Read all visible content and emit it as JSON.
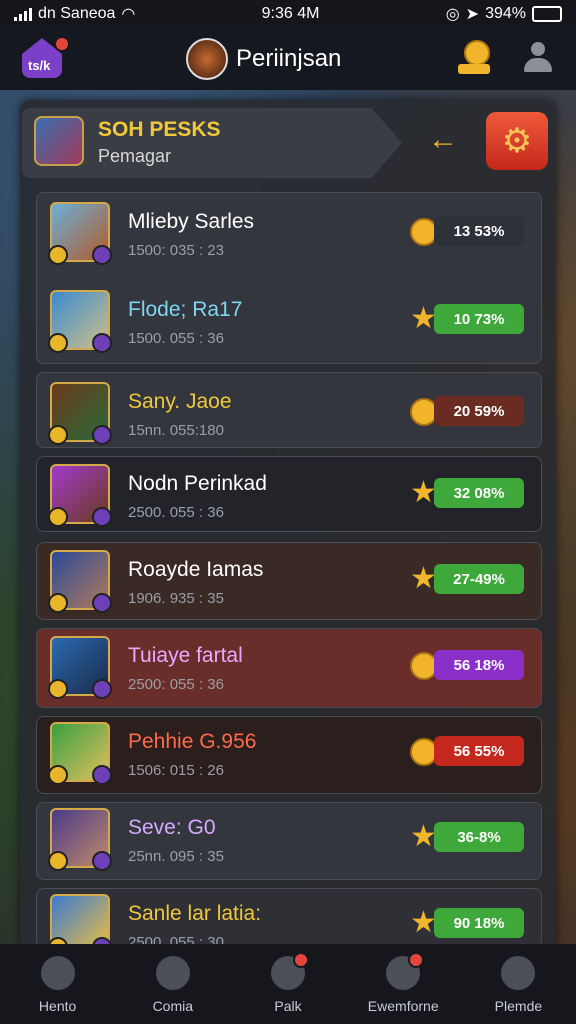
{
  "status": {
    "carrier": "dn Saneoa",
    "time": "9:36 4M",
    "battery": "394%"
  },
  "header": {
    "title": "Periinjsan",
    "home_label": "ts/k"
  },
  "section": {
    "title": "SOH PESKS",
    "subtitle": "Pemagar"
  },
  "colors": {
    "accent": "#f0c83a",
    "red": "#c4281c",
    "green": "#3fa83a",
    "purple": "#8a2fc8"
  },
  "rows": [
    {
      "name": "Mlieby Sarles",
      "meta": "1500: 035 : 23",
      "value": "13 53%",
      "icon": "coin-icon",
      "pill_color": "#2f3138",
      "name_color": "#ffffff"
    },
    {
      "name": "Flode; Ra17",
      "meta": "1500. 055 : 36",
      "value": "10 73%",
      "icon": "star-icon",
      "pill_color": "#3fa83a",
      "name_color": "#7fd6f0"
    },
    {
      "name": "Sany. Jaoe",
      "meta": "15nn. 055:180",
      "value": "20 59%",
      "icon": "coin-icon",
      "pill_color": "#6a2b22",
      "name_color": "#f0c83a"
    },
    {
      "name": "Nodn Perinkad",
      "meta": "2500. 055 : 36",
      "value": "32 08%",
      "icon": "star-icon",
      "pill_color": "#3fa83a",
      "name_color": "#ffffff"
    },
    {
      "name": "Roayde Iamas",
      "meta": "1906. 935 : 35",
      "value": "27-49%",
      "icon": "star-icon",
      "pill_color": "#3fa83a",
      "name_color": "#ffffff"
    },
    {
      "name": "Tuiaye fartal",
      "meta": "2500: 055 : 36",
      "value": "56 18%",
      "icon": "coin-icon",
      "pill_color": "#8a2fc8",
      "name_color": "#e8a8ff"
    },
    {
      "name": "Pehhie G.956",
      "meta": "1506: 015 : 26",
      "value": "56 55%",
      "icon": "coin-icon",
      "pill_color": "#c4281c",
      "name_color": "#ff6a4a"
    },
    {
      "name": "Seve: G0",
      "meta": "25nn. 095 : 35",
      "value": "36-8%",
      "icon": "star-icon",
      "pill_color": "#3fa83a",
      "name_color": "#d8a8ff"
    },
    {
      "name": "Sanle lar latia:",
      "meta": "2500. 055 : 30",
      "value": "90 18%",
      "icon": "star-icon",
      "pill_color": "#3fa83a",
      "name_color": "#f0c83a"
    }
  ],
  "tabs": [
    {
      "label": "Hento",
      "icon": "home-icon"
    },
    {
      "label": "Comia",
      "icon": "cat-icon"
    },
    {
      "label": "Palk",
      "icon": "pause-icon"
    },
    {
      "label": "Ewemforne",
      "icon": "record-icon"
    },
    {
      "label": "Plemde",
      "icon": "profile-icon"
    }
  ]
}
